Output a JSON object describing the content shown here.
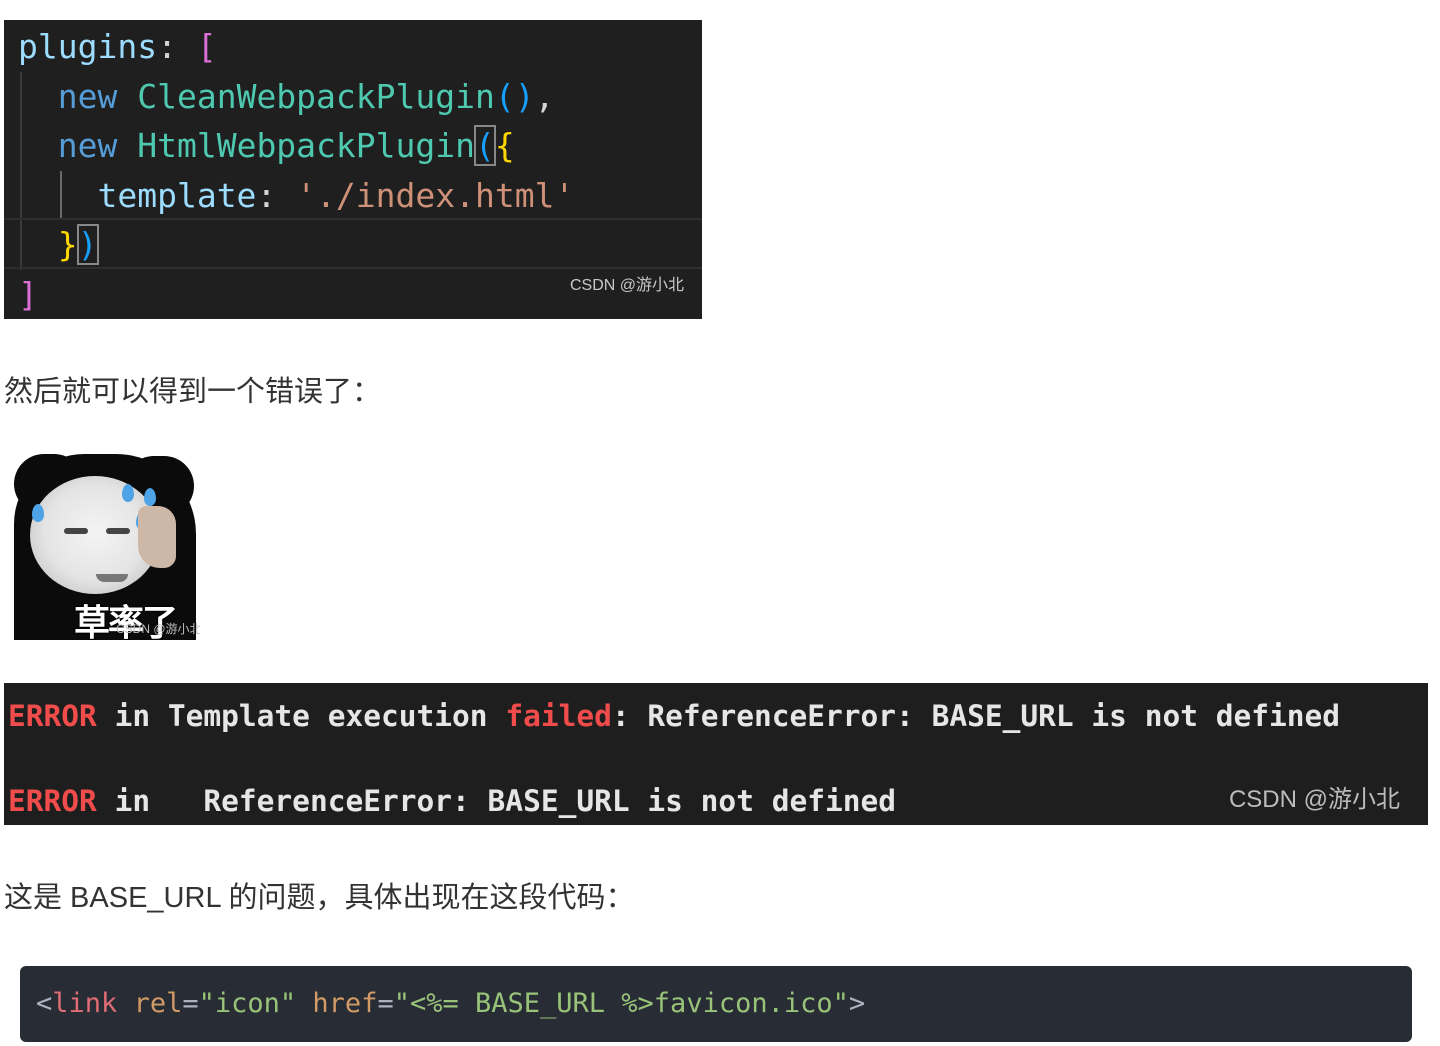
{
  "code_screenshot": {
    "lines": [
      {
        "prop": "plugins",
        "colon": ": ",
        "open_bracket": "["
      },
      {
        "kw": "new",
        "cls": "CleanWebpackPlugin",
        "parens": "()",
        "comma": ","
      },
      {
        "kw": "new",
        "cls": "HtmlWebpackPlugin",
        "open_paren": "(",
        "open_brace": "{"
      },
      {
        "prop": "template",
        "colon": ": ",
        "str": "'./index.html'"
      },
      {
        "close_brace": "}",
        "close_paren": ")"
      },
      {
        "close_bracket": "]"
      }
    ],
    "watermark": "CSDN @游小北"
  },
  "paragraph_1": "然后就可以得到一个错误了：",
  "meme": {
    "caption": "草率了",
    "watermark": "CSDN @游小北"
  },
  "terminal": {
    "line1": {
      "error": "ERROR",
      "in": " in Template execution ",
      "failed": "failed",
      "rest": ": ReferenceError: BASE_URL is not defined"
    },
    "line2": {
      "error": "ERROR",
      "rest": " in   ReferenceError: BASE_URL is not defined"
    },
    "watermark": "CSDN @游小北"
  },
  "paragraph_2": "这是 BASE_URL 的问题，具体出现在这段代码：",
  "code_block": {
    "lt": "<",
    "tag": "link",
    "attr1": "rel",
    "eq1": "=",
    "val1": "\"icon\"",
    "attr2": "href",
    "eq2": "=",
    "val2": "\"<%= BASE_URL %>favicon.ico\"",
    "gt": ">"
  }
}
